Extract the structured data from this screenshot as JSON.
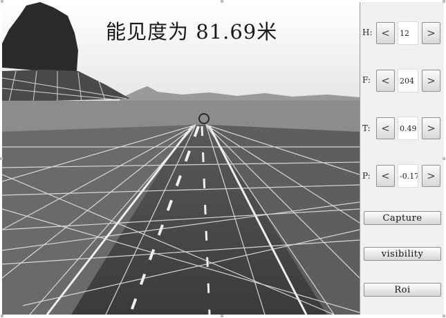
{
  "overlay": {
    "visibility_text": "能见度为  81.69米"
  },
  "controls": [
    {
      "label": "H:",
      "value": "12"
    },
    {
      "label": "F:",
      "value": "204"
    },
    {
      "label": "T:",
      "value": "0.49"
    },
    {
      "label": "P:",
      "value": "-0.17"
    }
  ],
  "spin": {
    "decrease_glyph": "<",
    "increase_glyph": ">"
  },
  "buttons": {
    "capture": "Capture",
    "visibility": "visibility",
    "roi": "Roi"
  }
}
